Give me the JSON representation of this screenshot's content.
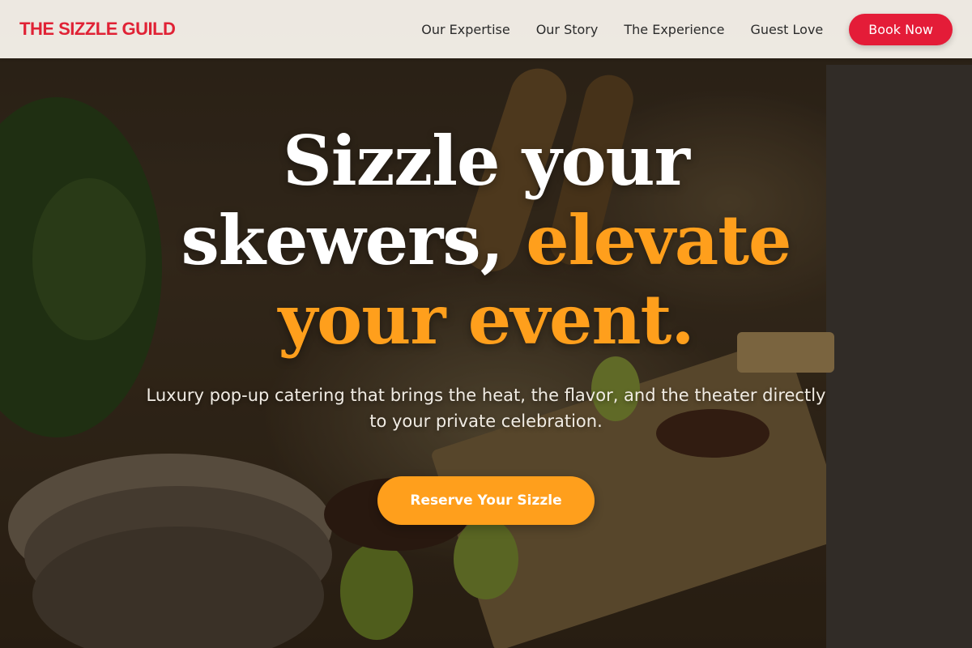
{
  "header": {
    "brand": "THE SIZZLE GUILD",
    "nav": [
      {
        "label": "Our Expertise"
      },
      {
        "label": "Our Story"
      },
      {
        "label": "The Experience"
      },
      {
        "label": "Guest Love"
      }
    ],
    "cta_label": "Book Now"
  },
  "hero": {
    "headline_line1": "Sizzle your",
    "headline_line2_plain": "skewers,",
    "headline_line2_accent": "elevate",
    "headline_line3_accent": "your event.",
    "subtitle": "Luxury pop-up catering that brings the heat, the flavor, and the theater directly to your private celebration.",
    "cta_label": "Reserve Your Sizzle"
  },
  "colors": {
    "brand_red": "#e41c38",
    "accent_orange": "#ff9f1c",
    "header_bg": "#faf5ee"
  }
}
